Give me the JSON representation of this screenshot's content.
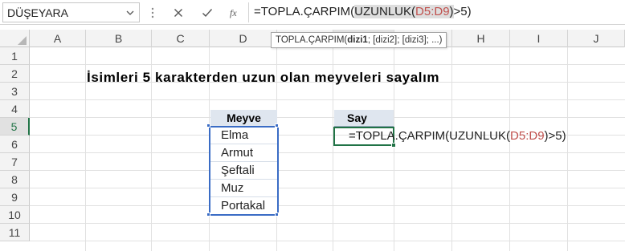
{
  "formula_bar": {
    "name_box": "DÜŞEYARA",
    "formula_prefix": "=TOPLA.ÇARPIM(",
    "formula_func": "UZUNLUK(",
    "formula_ref": "D5:D9",
    "formula_close": ")",
    "formula_suffix": ">5)"
  },
  "columns": [
    "A",
    "B",
    "C",
    "D",
    "E",
    "F",
    "G",
    "H",
    "I",
    "J"
  ],
  "rows": [
    "1",
    "2",
    "3",
    "4",
    "5",
    "6",
    "7",
    "8",
    "9",
    "10",
    "11"
  ],
  "tooltip": {
    "func": "TOPLA.ÇARPIM(",
    "arg1": "dizi1",
    "rest": "; [dizi2]; [dizi3]; ...)"
  },
  "title": "İsimleri 5 karakterden uzun olan meyveleri sayalım",
  "fruit_table": {
    "header": "Meyve",
    "items": [
      "Elma",
      "Armut",
      "Şeftali",
      "Muz",
      "Portakal"
    ]
  },
  "count_table": {
    "header": "Say"
  },
  "cell_edit": {
    "prefix": "=TOPLA.ÇARPIM(UZUNLUK(",
    "ref": "D5:D9",
    "close": ")",
    "suffix": ">5)"
  },
  "colors": {
    "accent_green": "#217346",
    "range_blue": "#3a6cc5",
    "ref_red": "#c0504d",
    "table_header": "#dfe6ef"
  }
}
